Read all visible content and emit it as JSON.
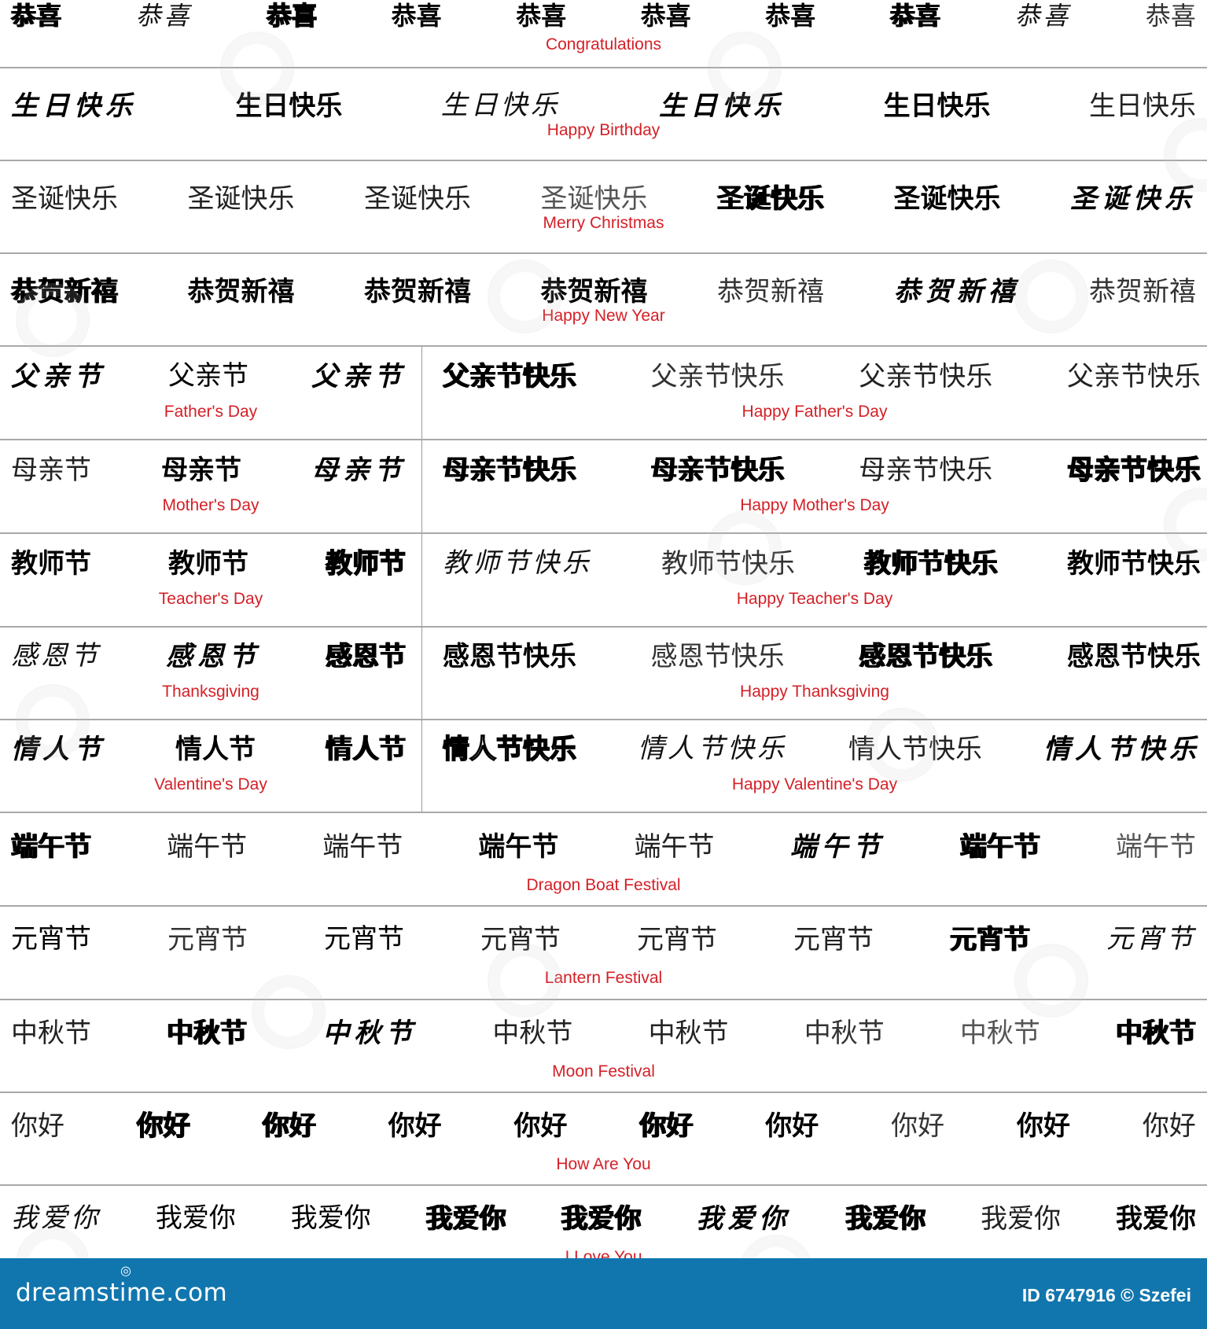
{
  "rows": [
    {
      "id": "congratulations",
      "label": "Congratulations",
      "variants": [
        {
          "text": "恭喜",
          "style": "heavy"
        },
        {
          "text": "恭喜",
          "style": "callig"
        },
        {
          "text": "恭喜",
          "style": "outline"
        },
        {
          "text": "恭喜",
          "style": "bold"
        },
        {
          "text": "恭喜",
          "style": "bold"
        },
        {
          "text": "恭喜",
          "style": "bold"
        },
        {
          "text": "恭喜",
          "style": "bold"
        },
        {
          "text": "恭喜",
          "style": "heavy"
        },
        {
          "text": "恭喜",
          "style": "callig"
        },
        {
          "text": "恭喜",
          "style": "thin"
        }
      ]
    },
    {
      "id": "birthday",
      "label": "Happy Birthday",
      "variants": [
        {
          "text": "生日快乐",
          "style": "brush"
        },
        {
          "text": "生日快乐",
          "style": "bold"
        },
        {
          "text": "生日快乐",
          "style": "callig"
        },
        {
          "text": "生日快乐",
          "style": "brush"
        },
        {
          "text": "生日快乐",
          "style": "bold"
        },
        {
          "text": "生日快乐",
          "style": "light"
        }
      ]
    },
    {
      "id": "christmas",
      "label": "Merry Christmas",
      "variants": [
        {
          "text": "圣诞快乐",
          "style": "light"
        },
        {
          "text": "圣诞快乐",
          "style": "light"
        },
        {
          "text": "圣诞快乐",
          "style": "light"
        },
        {
          "text": "圣诞快乐",
          "style": "gray"
        },
        {
          "text": "圣诞快乐",
          "style": "heavy"
        },
        {
          "text": "圣诞快乐",
          "style": "bold"
        },
        {
          "text": "圣诞快乐",
          "style": "brush"
        }
      ]
    },
    {
      "id": "new-year",
      "label": "Happy New Year",
      "variants": [
        {
          "text": "恭贺新禧",
          "style": "heavy"
        },
        {
          "text": "恭贺新禧",
          "style": "bold"
        },
        {
          "text": "恭贺新禧",
          "style": "bold"
        },
        {
          "text": "恭贺新禧",
          "style": "bold"
        },
        {
          "text": "恭贺新禧",
          "style": "thin"
        },
        {
          "text": "恭贺新禧",
          "style": "brush"
        },
        {
          "text": "恭贺新禧",
          "style": "thin"
        }
      ]
    }
  ],
  "split_rows": [
    {
      "id": "fathers-day",
      "left": {
        "label": "Father's Day",
        "variants": [
          {
            "text": "父亲节",
            "style": "brush"
          },
          {
            "text": "父亲节",
            "style": "serif"
          },
          {
            "text": "父亲节",
            "style": "brush"
          }
        ]
      },
      "right": {
        "label": "Happy Father's Day",
        "variants": [
          {
            "text": "父亲节快乐",
            "style": "heavy"
          },
          {
            "text": "父亲节快乐",
            "style": "thin"
          },
          {
            "text": "父亲节快乐",
            "style": "light"
          },
          {
            "text": "父亲节快乐",
            "style": "light"
          }
        ]
      }
    },
    {
      "id": "mothers-day",
      "left": {
        "label": "Mother's Day",
        "variants": [
          {
            "text": "母亲节",
            "style": "light"
          },
          {
            "text": "母亲节",
            "style": "bold"
          },
          {
            "text": "母亲节",
            "style": "brush"
          }
        ]
      },
      "right": {
        "label": "Happy Mother's Day",
        "variants": [
          {
            "text": "母亲节快乐",
            "style": "heavy"
          },
          {
            "text": "母亲节快乐",
            "style": "heavy"
          },
          {
            "text": "母亲节快乐",
            "style": "light"
          },
          {
            "text": "母亲节快乐",
            "style": "outline"
          }
        ]
      }
    },
    {
      "id": "teachers-day",
      "left": {
        "label": "Teacher's Day",
        "variants": [
          {
            "text": "教师节",
            "style": "bold"
          },
          {
            "text": "教师节",
            "style": "bold"
          },
          {
            "text": "教师节",
            "style": "outline"
          }
        ]
      },
      "right": {
        "label": "Happy Teacher's Day",
        "variants": [
          {
            "text": "教师节快乐",
            "style": "callig"
          },
          {
            "text": "教师节快乐",
            "style": "thin"
          },
          {
            "text": "教师节快乐",
            "style": "heavy"
          },
          {
            "text": "教师节快乐",
            "style": "bold"
          }
        ]
      }
    },
    {
      "id": "thanksgiving",
      "left": {
        "label": "Thanksgiving",
        "variants": [
          {
            "text": "感恩节",
            "style": "callig"
          },
          {
            "text": "感恩节",
            "style": "brush"
          },
          {
            "text": "感恩节",
            "style": "heavy"
          }
        ]
      },
      "right": {
        "label": "Happy Thanksgiving",
        "variants": [
          {
            "text": "感恩节快乐",
            "style": "bold"
          },
          {
            "text": "感恩节快乐",
            "style": "thin"
          },
          {
            "text": "感恩节快乐",
            "style": "heavy"
          },
          {
            "text": "感恩节快乐",
            "style": "bold"
          }
        ]
      }
    },
    {
      "id": "valentines-day",
      "left": {
        "label": "Valentine's Day",
        "variants": [
          {
            "text": "情人节",
            "style": "brush"
          },
          {
            "text": "情人节",
            "style": "bold"
          },
          {
            "text": "情人节",
            "style": "heavy"
          }
        ]
      },
      "right": {
        "label": "Happy Valentine's Day",
        "variants": [
          {
            "text": "情人节快乐",
            "style": "outline"
          },
          {
            "text": "情人节快乐",
            "style": "callig"
          },
          {
            "text": "情人节快乐",
            "style": "light"
          },
          {
            "text": "情人节快乐",
            "style": "brush"
          }
        ]
      }
    }
  ],
  "rows_bottom": [
    {
      "id": "dragon-boat",
      "label": "Dragon Boat Festival",
      "variants": [
        {
          "text": "端午节",
          "style": "heavy"
        },
        {
          "text": "端午节",
          "style": "light"
        },
        {
          "text": "端午节",
          "style": "light"
        },
        {
          "text": "端午节",
          "style": "bold"
        },
        {
          "text": "端午节",
          "style": "light"
        },
        {
          "text": "端午节",
          "style": "brush"
        },
        {
          "text": "端午节",
          "style": "heavy"
        },
        {
          "text": "端午节",
          "style": "gray"
        }
      ]
    },
    {
      "id": "lantern",
      "label": "Lantern Festival",
      "variants": [
        {
          "text": "元宵节",
          "style": "serif"
        },
        {
          "text": "元宵节",
          "style": "thin"
        },
        {
          "text": "元宵节",
          "style": "serif"
        },
        {
          "text": "元宵节",
          "style": "light"
        },
        {
          "text": "元宵节",
          "style": "light"
        },
        {
          "text": "元宵节",
          "style": "light"
        },
        {
          "text": "元宵节",
          "style": "heavy"
        },
        {
          "text": "元宵节",
          "style": "callig"
        }
      ]
    },
    {
      "id": "moon",
      "label": "Moon Festival",
      "variants": [
        {
          "text": "中秋节",
          "style": "light"
        },
        {
          "text": "中秋节",
          "style": "heavy"
        },
        {
          "text": "中秋节",
          "style": "brush"
        },
        {
          "text": "中秋节",
          "style": "light"
        },
        {
          "text": "中秋节",
          "style": "light"
        },
        {
          "text": "中秋节",
          "style": "thin"
        },
        {
          "text": "中秋节",
          "style": "gray"
        },
        {
          "text": "中秋节",
          "style": "heavy"
        }
      ]
    },
    {
      "id": "how-are-you",
      "label": "How Are You",
      "variants": [
        {
          "text": "你好",
          "style": "light"
        },
        {
          "text": "你好",
          "style": "outline"
        },
        {
          "text": "你好",
          "style": "heavy"
        },
        {
          "text": "你好",
          "style": "bold"
        },
        {
          "text": "你好",
          "style": "bold"
        },
        {
          "text": "你好",
          "style": "heavy"
        },
        {
          "text": "你好",
          "style": "bold"
        },
        {
          "text": "你好",
          "style": "thin"
        },
        {
          "text": "你好",
          "style": "bold"
        },
        {
          "text": "你好",
          "style": "light"
        }
      ]
    },
    {
      "id": "i-love-you",
      "label": "I Love You",
      "variants": [
        {
          "text": "我爱你",
          "style": "callig"
        },
        {
          "text": "我爱你",
          "style": "serif"
        },
        {
          "text": "我爱你",
          "style": "serif"
        },
        {
          "text": "我爱你",
          "style": "heavy"
        },
        {
          "text": "我爱你",
          "style": "heavy"
        },
        {
          "text": "我爱你",
          "style": "brush"
        },
        {
          "text": "我爱你",
          "style": "heavy"
        },
        {
          "text": "我爱你",
          "style": "light"
        },
        {
          "text": "我爱你",
          "style": "bold"
        }
      ]
    }
  ],
  "footer": {
    "brand": "dreamstime.com",
    "brand_mark": "◎",
    "credit": "ID 6747916 © Szefei"
  },
  "colors": {
    "label_red": "#d42027",
    "footer_blue": "#1176ae",
    "divider_gray": "#a8a8a8"
  }
}
